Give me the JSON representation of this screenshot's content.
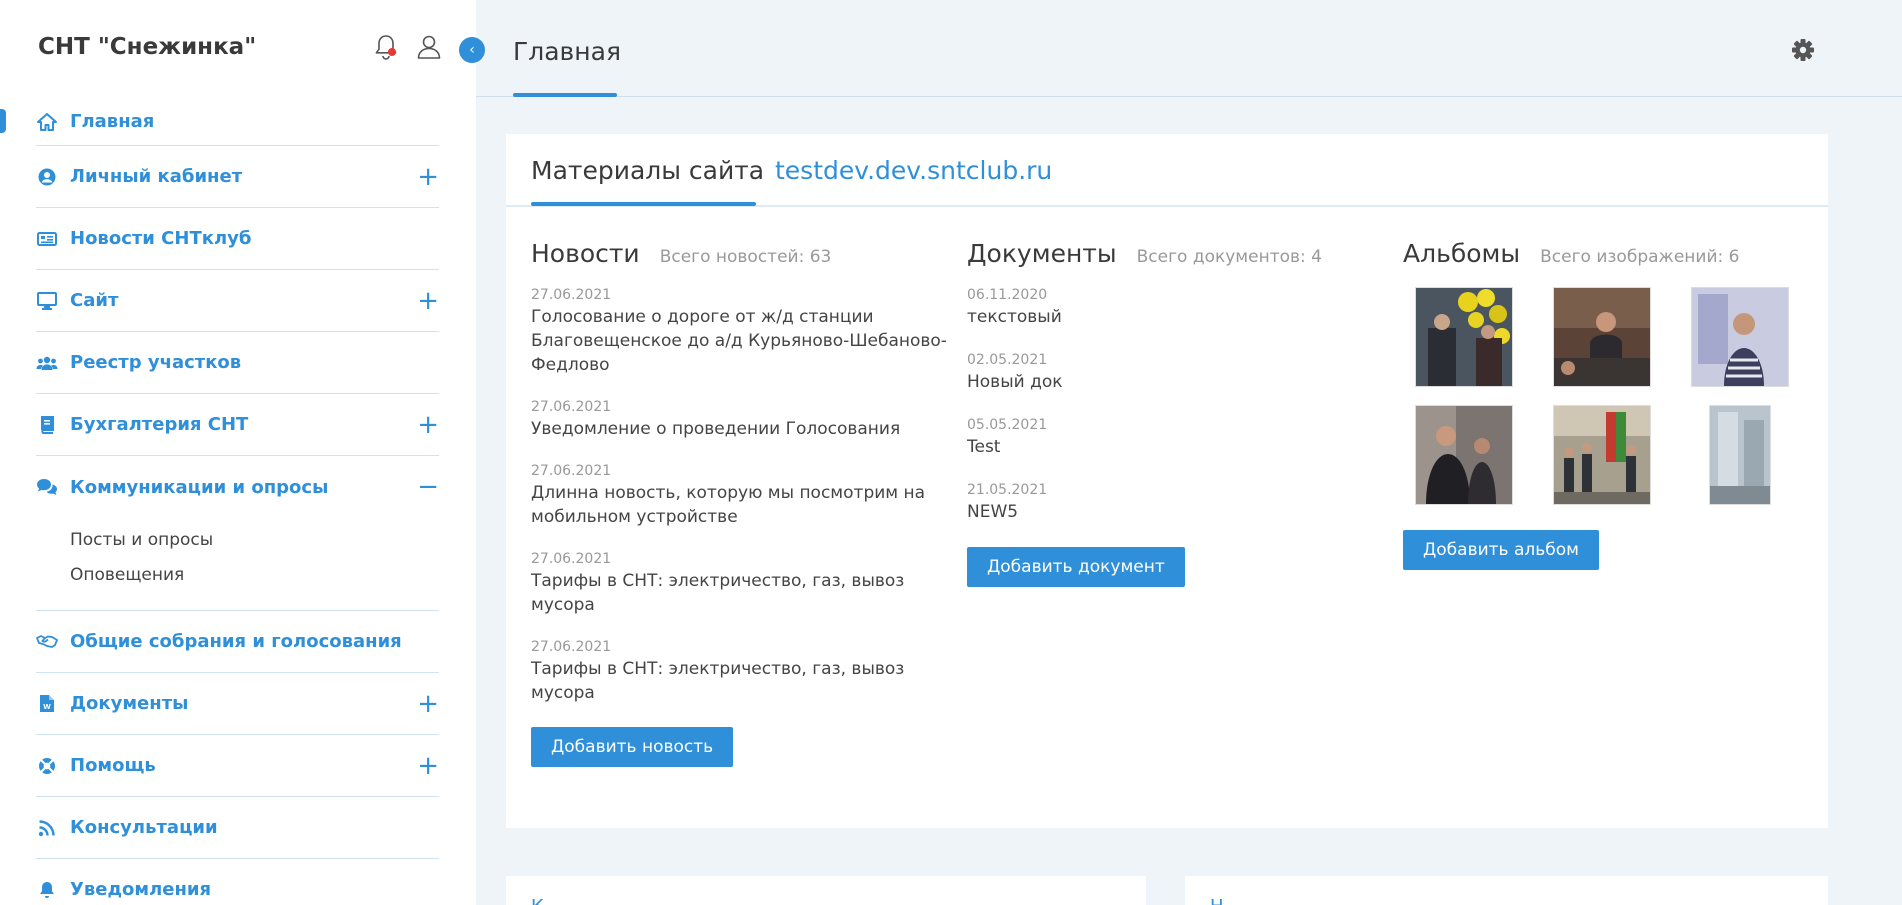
{
  "sidebar": {
    "brand": "СНТ \"Снежинка\"",
    "items": [
      {
        "label": "Главная",
        "icon": "home-icon",
        "toggle": ""
      },
      {
        "label": "Личный кабинет",
        "icon": "user-circle-icon",
        "toggle": "+"
      },
      {
        "label": "Новости СНТклуб",
        "icon": "newspaper-icon",
        "toggle": ""
      },
      {
        "label": "Сайт",
        "icon": "desktop-icon",
        "toggle": "+"
      },
      {
        "label": "Реестр участков",
        "icon": "users-icon",
        "toggle": ""
      },
      {
        "label": "Бухгалтерия СНТ",
        "icon": "book-icon",
        "toggle": "+"
      },
      {
        "label": "Коммуникации и опросы",
        "icon": "comments-icon",
        "toggle": "−"
      },
      {
        "label": "Общие собрания и голосования",
        "icon": "handshake-icon",
        "toggle": ""
      },
      {
        "label": "Документы",
        "icon": "word-file-icon",
        "toggle": "+"
      },
      {
        "label": "Помощь",
        "icon": "lifebuoy-icon",
        "toggle": "+"
      },
      {
        "label": "Консультации",
        "icon": "rss-icon",
        "toggle": ""
      },
      {
        "label": "Уведомления",
        "icon": "bell-icon",
        "toggle": ""
      }
    ],
    "subitems": [
      "Посты и опросы",
      "Оповещения"
    ]
  },
  "header": {
    "title": "Главная",
    "collapse_glyph": "‹"
  },
  "card": {
    "title": "Материалы сайта",
    "domain": "testdev.dev.sntclub.ru"
  },
  "news": {
    "title": "Новости",
    "count": "Всего новостей: 63",
    "items": [
      {
        "date": "27.06.2021",
        "text": "Голосование о дороге от ж/д станции Благовещенское до а/д Курьяново-Шебаново-Федлово"
      },
      {
        "date": "27.06.2021",
        "text": "Уведомление о проведении Голосования"
      },
      {
        "date": "27.06.2021",
        "text": "Длинна новость, которую мы посмотрим на мобильном устройстве"
      },
      {
        "date": "27.06.2021",
        "text": "Тарифы в СНТ: электричество, газ, вывоз мусора"
      },
      {
        "date": "27.06.2021",
        "text": "Тарифы в СНТ: электричество, газ, вывоз мусора"
      }
    ],
    "button": "Добавить новость"
  },
  "documents": {
    "title": "Документы",
    "count": "Всего документов: 4",
    "items": [
      {
        "date": "06.11.2020",
        "text": "текстовый"
      },
      {
        "date": "02.05.2021",
        "text": "Новый док"
      },
      {
        "date": "05.05.2021",
        "text": "Test"
      },
      {
        "date": "21.05.2021",
        "text": "NEW5"
      }
    ],
    "button": "Добавить документ"
  },
  "albums": {
    "title": "Альбомы",
    "count": "Всего изображений: 6",
    "button": "Добавить альбом"
  },
  "bottom": {
    "left": "К",
    "right": "Н"
  },
  "colors": {
    "accent": "#2f8fd8",
    "background": "#eef4f8",
    "notification_dot": "#e53935"
  }
}
